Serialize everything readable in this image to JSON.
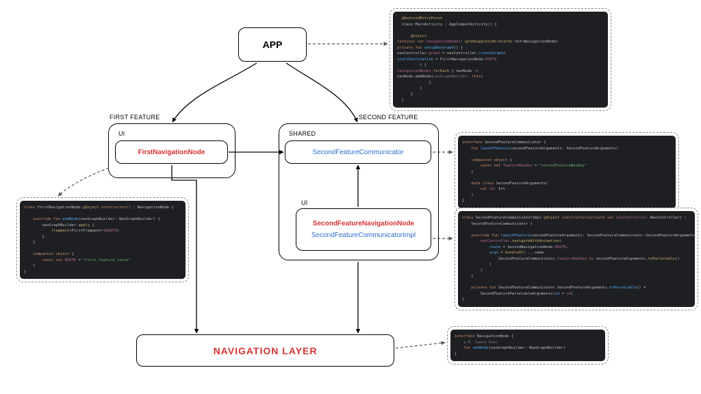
{
  "diagram": {
    "app_label": "APP",
    "first_feature_label": "FIRST FEATURE",
    "second_feature_label": "SECOND FEATURE",
    "ui_label": "UI",
    "shared_label": "SHARED",
    "first_nav_node": "FirstNavigationNode",
    "second_feature_communicator": "SecondFeatureCommunicator",
    "second_feature_nav_node": "SecondFeatureNavigationNode",
    "second_feature_comm_impl": "SecondFeatureCommunicatorImpl",
    "nav_layer": "NAVIGATION LAYER"
  },
  "code": {
    "app": [
      {
        "c": "kw-yellow",
        "t": "  @AndroidEntryPoint"
      },
      {
        "c": "",
        "t": "  class MainActivity : AppCompatActivity() {",
        "pre": "kw-orange:class"
      },
      {
        "c": "",
        "t": ""
      },
      {
        "c": "kw-yellow",
        "t": "      @Inject"
      },
      {
        "c": "",
        "t": "      lateinit var navigationNodes: @JvmSuppressWildcards Set<NavigationNode>",
        "markup": true,
        "seg": [
          {
            "c": "kw-orange",
            "t": "lateinit var "
          },
          {
            "c": "kw-pink",
            "t": "navigationNodes"
          },
          {
            "c": "",
            "t": ": "
          },
          {
            "c": "kw-yellow",
            "t": "@JvmSuppressWildcards"
          },
          {
            "c": "",
            "t": " Set<NavigationNode>"
          }
        ]
      },
      {
        "c": "",
        "t": "      private fun setupNavGraph() {",
        "markup": true,
        "seg": [
          {
            "c": "kw-orange",
            "t": "private fun "
          },
          {
            "c": "kw-blue",
            "t": "setupNavGraph"
          },
          {
            "c": "",
            "t": "() {"
          }
        ]
      },
      {
        "c": "",
        "t": "          navController.graph = navController.createGraph(",
        "markup": true,
        "seg": [
          {
            "c": "",
            "t": "navController."
          },
          {
            "c": "kw-pink",
            "t": "graph"
          },
          {
            "c": "",
            "t": " = navController."
          },
          {
            "c": "kw-blue",
            "t": "createGraph"
          },
          {
            "c": "",
            "t": "("
          }
        ]
      },
      {
        "c": "",
        "t": "              startDestination = FirstNavigationNode.ROUTE",
        "markup": true,
        "seg": [
          {
            "c": "kw-blue",
            "t": "startDestination"
          },
          {
            "c": "",
            "t": " = FirstNavigationNode."
          },
          {
            "c": "kw-pink",
            "t": "ROUTE"
          }
        ]
      },
      {
        "c": "",
        "t": "          ) {"
      },
      {
        "c": "",
        "t": "              navigationNodes.forEach { navNode ->",
        "markup": true,
        "seg": [
          {
            "c": "kw-pink",
            "t": "navigationNodes"
          },
          {
            "c": "",
            "t": "."
          },
          {
            "c": "kw-yellow",
            "t": "forEach"
          },
          {
            "c": "",
            "t": " { navNode ->"
          }
        ]
      },
      {
        "c": "",
        "t": "                  navNode.addNode(navGraphBuilder: this)",
        "markup": true,
        "seg": [
          {
            "c": "",
            "t": "navNode.addNode("
          },
          {
            "c": "kw-grey",
            "t": "navGraphBuilder: "
          },
          {
            "c": "kw-orange",
            "t": "this"
          },
          {
            "c": "",
            "t": ")"
          }
        ]
      },
      {
        "c": "",
        "t": "              }"
      },
      {
        "c": "",
        "t": "          }"
      },
      {
        "c": "",
        "t": "      }"
      },
      {
        "c": "",
        "t": "  }"
      }
    ],
    "first_nav": [
      {
        "c": "",
        "markup": true,
        "seg": [
          {
            "c": "kw-orange",
            "t": "class "
          },
          {
            "c": "",
            "t": "FirstNavigationNode "
          },
          {
            "c": "kw-yellow",
            "t": "@Inject"
          },
          {
            "c": "",
            "t": " "
          },
          {
            "c": "kw-orange",
            "t": "constructor"
          },
          {
            "c": "",
            "t": "() : NavigationNode {"
          }
        ]
      },
      {
        "c": "",
        "t": ""
      },
      {
        "c": "",
        "markup": true,
        "seg": [
          {
            "c": "kw-orange",
            "t": "    override fun "
          },
          {
            "c": "kw-blue",
            "t": "addNode"
          },
          {
            "c": "",
            "t": "(navGraphBuilder: NavGraphBuilder) {"
          }
        ]
      },
      {
        "c": "",
        "markup": true,
        "seg": [
          {
            "c": "",
            "t": "        navGraphBuilder."
          },
          {
            "c": "kw-yellow",
            "t": "apply"
          },
          {
            "c": "",
            "t": " {"
          }
        ]
      },
      {
        "c": "",
        "markup": true,
        "seg": [
          {
            "c": "",
            "t": "            "
          },
          {
            "c": "kw-yellow",
            "t": "fragment"
          },
          {
            "c": "",
            "t": "<FirstFragment>("
          },
          {
            "c": "kw-pink",
            "t": "ROUTE"
          },
          {
            "c": "",
            "t": ")"
          }
        ]
      },
      {
        "c": "",
        "t": "        }"
      },
      {
        "c": "",
        "t": "    }"
      },
      {
        "c": "",
        "t": ""
      },
      {
        "c": "",
        "markup": true,
        "seg": [
          {
            "c": "kw-orange",
            "t": "    companion object"
          },
          {
            "c": "",
            "t": " {"
          }
        ]
      },
      {
        "c": "",
        "markup": true,
        "seg": [
          {
            "c": "kw-orange",
            "t": "        const val "
          },
          {
            "c": "kw-pink",
            "t": "ROUTE"
          },
          {
            "c": "",
            "t": " = "
          },
          {
            "c": "kw-green",
            "t": "\"first_feature_route\""
          }
        ]
      },
      {
        "c": "",
        "t": "    }"
      },
      {
        "c": "",
        "t": "}"
      }
    ],
    "sfc": [
      {
        "c": "",
        "markup": true,
        "seg": [
          {
            "c": "kw-orange",
            "t": "interface "
          },
          {
            "c": "",
            "t": "SecondFeatureCommunicator {"
          }
        ]
      },
      {
        "c": "",
        "markup": true,
        "seg": [
          {
            "c": "kw-orange",
            "t": "    fun "
          },
          {
            "c": "kw-blue",
            "t": "launchFeature"
          },
          {
            "c": "",
            "t": "(secondFeatureArguments: SecondFeatureArguments)"
          }
        ]
      },
      {
        "c": "",
        "t": ""
      },
      {
        "c": "",
        "markup": true,
        "seg": [
          {
            "c": "kw-orange",
            "t": "    companion object"
          },
          {
            "c": "",
            "t": " {"
          }
        ]
      },
      {
        "c": "",
        "markup": true,
        "seg": [
          {
            "c": "kw-orange",
            "t": "        const val "
          },
          {
            "c": "kw-pink",
            "t": "featureNavKey"
          },
          {
            "c": "",
            "t": " = "
          },
          {
            "c": "kw-green",
            "t": "\"secondFeatureNavKey\""
          }
        ]
      },
      {
        "c": "",
        "t": "    }"
      },
      {
        "c": "",
        "t": ""
      },
      {
        "c": "",
        "markup": true,
        "seg": [
          {
            "c": "kw-orange",
            "t": "    data class "
          },
          {
            "c": "",
            "t": "SecondFeatureArguments("
          }
        ]
      },
      {
        "c": "",
        "markup": true,
        "seg": [
          {
            "c": "kw-orange",
            "t": "        val "
          },
          {
            "c": "kw-pink",
            "t": "id"
          },
          {
            "c": "",
            "t": ": Int"
          }
        ]
      },
      {
        "c": "",
        "t": "    )"
      },
      {
        "c": "",
        "t": "}"
      }
    ],
    "sfc_impl": [
      {
        "c": "",
        "markup": true,
        "seg": [
          {
            "c": "kw-orange",
            "t": "class "
          },
          {
            "c": "",
            "t": "SecondFeatureCommunicatorImpl "
          },
          {
            "c": "kw-yellow",
            "t": "@Inject"
          },
          {
            "c": "",
            "t": " "
          },
          {
            "c": "kw-orange",
            "t": "constructor"
          },
          {
            "c": "",
            "t": "("
          },
          {
            "c": "kw-orange",
            "t": "private val "
          },
          {
            "c": "kw-pink",
            "t": "navController"
          },
          {
            "c": "",
            "t": ": NavController) :"
          }
        ]
      },
      {
        "c": "",
        "t": "    SecondFeatureCommunicator {"
      },
      {
        "c": "",
        "t": ""
      },
      {
        "c": "",
        "markup": true,
        "seg": [
          {
            "c": "kw-orange",
            "t": "    override fun "
          },
          {
            "c": "kw-blue",
            "t": "launchFeature"
          },
          {
            "c": "",
            "t": "(secondFeatureArguments: SecondFeatureCommunicator.SecondFeatureArguments) {"
          }
        ]
      },
      {
        "c": "",
        "markup": true,
        "seg": [
          {
            "c": "",
            "t": "        "
          },
          {
            "c": "kw-pink",
            "t": "navController"
          },
          {
            "c": "",
            "t": "."
          },
          {
            "c": "kw-yellow",
            "t": "navigateWithAnimation"
          },
          {
            "c": "",
            "t": "("
          }
        ]
      },
      {
        "c": "",
        "markup": true,
        "seg": [
          {
            "c": "",
            "t": "            "
          },
          {
            "c": "kw-blue",
            "t": "route"
          },
          {
            "c": "",
            "t": " = SecondNavigationNode."
          },
          {
            "c": "kw-pink",
            "t": "ROUTE"
          },
          {
            "c": "",
            "t": ","
          }
        ]
      },
      {
        "c": "",
        "markup": true,
        "seg": [
          {
            "c": "",
            "t": "            "
          },
          {
            "c": "kw-blue",
            "t": "args"
          },
          {
            "c": "",
            "t": " = "
          },
          {
            "c": "kw-yellow",
            "t": "bundleOf"
          },
          {
            "c": "",
            "t": "( ...same"
          }
        ]
      },
      {
        "c": "",
        "markup": true,
        "seg": [
          {
            "c": "",
            "t": "                SecondFeatureCommunicator."
          },
          {
            "c": "kw-pink",
            "t": "featureNavKey"
          },
          {
            "c": "",
            "t": " "
          },
          {
            "c": "kw-orange",
            "t": "to"
          },
          {
            "c": "",
            "t": " secondFeatureArguments."
          },
          {
            "c": "kw-yellow",
            "t": "toParcelable"
          },
          {
            "c": "",
            "t": "()"
          }
        ]
      },
      {
        "c": "",
        "t": "            )"
      },
      {
        "c": "",
        "t": "        )"
      },
      {
        "c": "",
        "t": "    }"
      },
      {
        "c": "",
        "t": ""
      },
      {
        "c": "",
        "markup": true,
        "seg": [
          {
            "c": "kw-orange",
            "t": "    private fun "
          },
          {
            "c": "",
            "t": "SecondFeatureCommunicator.SecondFeatureArguments."
          },
          {
            "c": "kw-blue",
            "t": "toParcelable"
          },
          {
            "c": "",
            "t": "() ="
          }
        ]
      },
      {
        "c": "",
        "markup": true,
        "seg": [
          {
            "c": "",
            "t": "        SecondFeatureParcelableArguments("
          },
          {
            "c": "kw-blue",
            "t": "id"
          },
          {
            "c": "",
            "t": " = "
          },
          {
            "c": "kw-pink",
            "t": "id"
          },
          {
            "c": "",
            "t": ")"
          }
        ]
      },
      {
        "c": "",
        "t": "}"
      }
    ],
    "nav_node": [
      {
        "c": "",
        "markup": true,
        "seg": [
          {
            "c": "kw-orange",
            "t": "interface "
          },
          {
            "c": "",
            "t": "NavigationNode {"
          }
        ]
      },
      {
        "c": "kw-grey",
        "t": "    ± M. Cemre Ünal"
      },
      {
        "c": "",
        "markup": true,
        "seg": [
          {
            "c": "kw-orange",
            "t": "    fun "
          },
          {
            "c": "kw-blue",
            "t": "addNode"
          },
          {
            "c": "",
            "t": "(navGraphBuilder: NavGraphBuilder)"
          }
        ]
      },
      {
        "c": "",
        "t": "}"
      }
    ]
  }
}
